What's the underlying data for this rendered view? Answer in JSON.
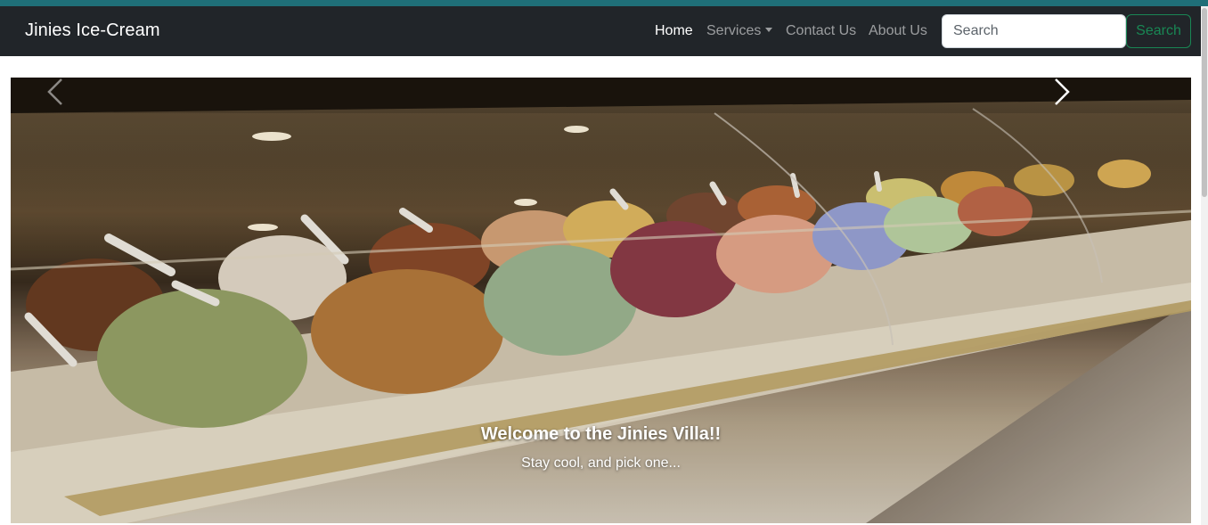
{
  "navbar": {
    "brand": "Jinies Ice-Cream",
    "links": [
      {
        "label": "Home",
        "active": true
      },
      {
        "label": "Services",
        "dropdown": true
      },
      {
        "label": "Contact Us"
      },
      {
        "label": "About Us"
      }
    ],
    "search": {
      "placeholder": "Search",
      "value": "",
      "button_label": "Search"
    }
  },
  "carousel": {
    "image": "ice-cream gelato display case",
    "prev_icon": "chevron-left-icon",
    "next_icon": "chevron-right-icon",
    "caption_title": "Welcome to the Jinies Villa!!",
    "caption_text": "Stay cool, and pick one..."
  },
  "colors": {
    "navbar_bg": "#212529",
    "top_strip": "#1f6f78",
    "search_button": "#198754"
  }
}
